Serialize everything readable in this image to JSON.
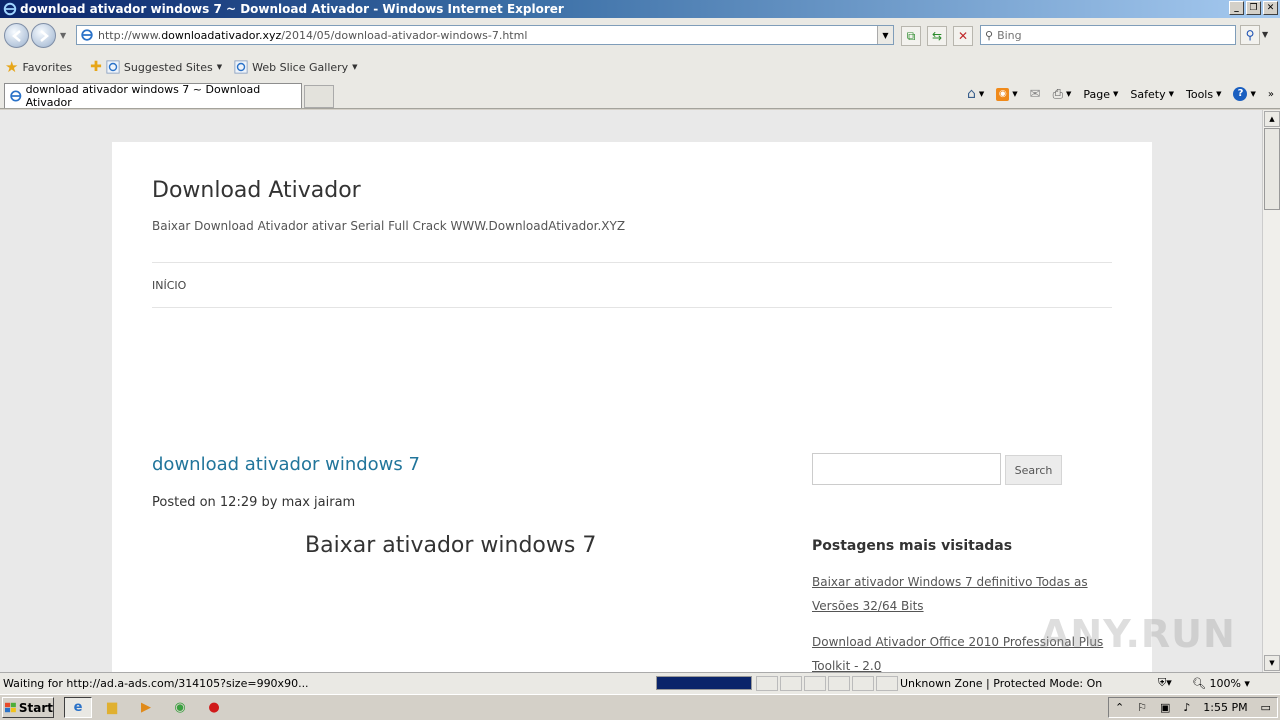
{
  "window": {
    "title": "download ativador windows 7 ~ Download Ativador - Windows Internet Explorer",
    "controls": [
      "_",
      "❐",
      "✕"
    ]
  },
  "address_bar": {
    "prefix": "http://www.",
    "domain": "downloadativador.xyz",
    "path": "/2014/05/download-ativador-windows-7.html"
  },
  "search": {
    "placeholder": "Bing"
  },
  "favorites_bar": {
    "favorites_label": "Favorites",
    "suggested_sites_label": "Suggested Sites",
    "web_slice_label": "Web Slice Gallery"
  },
  "tab": {
    "title": "download ativador windows 7 ~ Download Ativador"
  },
  "command_bar": {
    "page": "Page",
    "safety": "Safety",
    "tools": "Tools"
  },
  "page": {
    "site_title": "Download Ativador",
    "site_description": "Baixar Download Ativador ativar Serial Full Crack WWW.DownloadAtivador.XYZ",
    "menu_home": "INÍCIO",
    "post_title": "download ativador windows 7",
    "post_meta": "Posted on 12:29 by max jairam",
    "post_heading": "Baixar ativador windows 7",
    "sidebar": {
      "search_button": "Search",
      "popular_heading": "Postagens mais visitadas",
      "popular_links": [
        "Baixar ativador Windows 7 definitivo Todas as Versões 32/64 Bits",
        "Download Ativador Office 2010 Professional Plus Toolkit - 2.0"
      ]
    },
    "watermark": "ANY.RUN"
  },
  "status_bar": {
    "status_text": "Waiting for http://ad.a-ads.com/314105?size=990x90...",
    "progress": 1.0,
    "zone": "Unknown Zone | Protected Mode: On",
    "zoom": "100%"
  },
  "taskbar": {
    "start_label": "Start",
    "clock": "1:55 PM"
  },
  "colors": {
    "link": "#21759b",
    "titlebar_start": "#0a246a",
    "progress": "#0a246a"
  }
}
